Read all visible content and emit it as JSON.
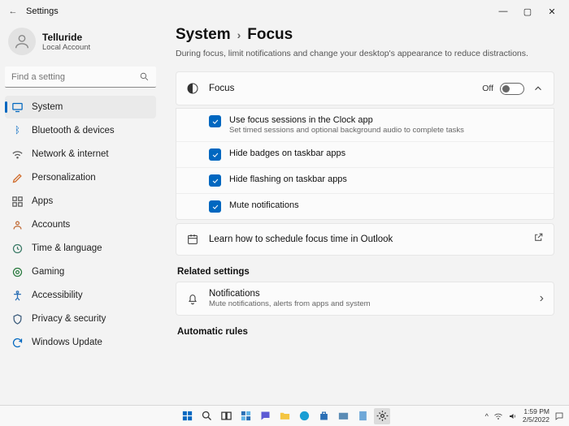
{
  "window": {
    "title": "Settings"
  },
  "user": {
    "name": "Telluride",
    "sub": "Local Account"
  },
  "search": {
    "placeholder": "Find a setting"
  },
  "nav": {
    "items": [
      {
        "label": "System",
        "color": "#0067c0"
      },
      {
        "label": "Bluetooth & devices",
        "color": "#0067c0"
      },
      {
        "label": "Network & internet",
        "color": "#5b5b5b"
      },
      {
        "label": "Personalization",
        "color": "#d06b2a"
      },
      {
        "label": "Apps",
        "color": "#5b5b5b"
      },
      {
        "label": "Accounts",
        "color": "#c06a35"
      },
      {
        "label": "Time & language",
        "color": "#3a7a66"
      },
      {
        "label": "Gaming",
        "color": "#2a7a3f"
      },
      {
        "label": "Accessibility",
        "color": "#2a6fb5"
      },
      {
        "label": "Privacy & security",
        "color": "#3a5a7a"
      },
      {
        "label": "Windows Update",
        "color": "#0067c0"
      }
    ]
  },
  "breadcrumb": {
    "parent": "System",
    "current": "Focus"
  },
  "page": {
    "desc": "During focus, limit notifications and change your desktop's appearance to reduce distractions."
  },
  "focus": {
    "title": "Focus",
    "state": "Off",
    "options": [
      {
        "label": "Use focus sessions in the Clock app",
        "desc": "Set timed sessions and optional background audio to complete tasks"
      },
      {
        "label": "Hide badges on taskbar apps"
      },
      {
        "label": "Hide flashing on taskbar apps"
      },
      {
        "label": "Mute notifications"
      }
    ],
    "link": "Learn how to schedule focus time in Outlook"
  },
  "related": {
    "heading": "Related settings",
    "item": {
      "title": "Notifications",
      "desc": "Mute notifications, alerts from apps and system"
    }
  },
  "auto": {
    "heading": "Automatic rules"
  },
  "taskbar": {
    "time": "1:59 PM",
    "date": "2/5/2022"
  }
}
